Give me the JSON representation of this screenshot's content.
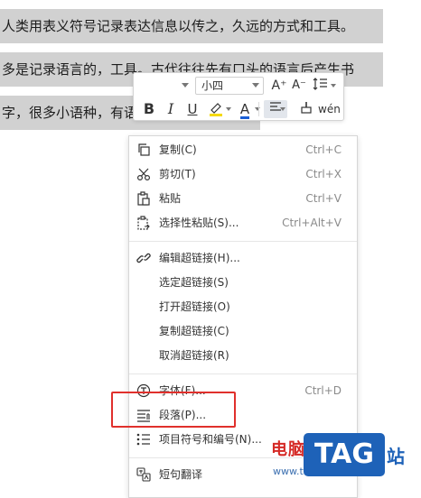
{
  "document": {
    "lines": [
      "人类用表义符号记录表达信息以传之，久远的方式和工具。",
      "多是记录语言的，工具。古代往往先有口头的语言后产生书",
      "字，很多小语种，有语言但没有文字。"
    ]
  },
  "toolbar": {
    "font_value": "",
    "size_value": "小四",
    "bold": "B",
    "italic": "I",
    "underline": "U",
    "font_color_letter": "A",
    "grow_font": "A⁺",
    "shrink_font": "A⁻",
    "pinyin": "wén",
    "accent_color": "#1a5fd6",
    "highlight_color": "#f5d90a"
  },
  "context_menu": {
    "items": [
      {
        "id": "copy",
        "label": "复制(C)",
        "shortcut": "Ctrl+C",
        "icon": "copy-icon"
      },
      {
        "id": "cut",
        "label": "剪切(T)",
        "shortcut": "Ctrl+X",
        "icon": "scissors-icon"
      },
      {
        "id": "paste",
        "label": "粘贴",
        "shortcut": "Ctrl+V",
        "icon": "paste-icon"
      },
      {
        "id": "paste-special",
        "label": "选择性粘贴(S)...",
        "shortcut": "Ctrl+Alt+V",
        "icon": "paste-special-icon"
      },
      {
        "id": "edit-hyperlink",
        "label": "编辑超链接(H)...",
        "shortcut": "",
        "icon": "link-icon"
      },
      {
        "id": "select-hyperlink",
        "label": "选定超链接(S)",
        "shortcut": "",
        "icon": ""
      },
      {
        "id": "open-hyperlink",
        "label": "打开超链接(O)",
        "shortcut": "",
        "icon": ""
      },
      {
        "id": "copy-hyperlink",
        "label": "复制超链接(C)",
        "shortcut": "",
        "icon": ""
      },
      {
        "id": "remove-hyperlink",
        "label": "取消超链接(R)",
        "shortcut": "",
        "icon": ""
      },
      {
        "id": "font",
        "label": "字体(F)...",
        "shortcut": "Ctrl+D",
        "icon": "font-icon"
      },
      {
        "id": "paragraph",
        "label": "段落(P)...",
        "shortcut": "",
        "icon": "paragraph-icon"
      },
      {
        "id": "bullets",
        "label": "项目符号和编号(N)...",
        "shortcut": "",
        "icon": "list-icon"
      },
      {
        "id": "translate",
        "label": "短句翻译",
        "shortcut": "",
        "icon": "translate-icon"
      }
    ]
  },
  "watermark": {
    "site_name": "电脑技术网",
    "url": "www.tagxp.com",
    "tag": "TAG",
    "zhan": "站",
    "brand_red": "#d52a26",
    "brand_blue": "#1e62b8"
  }
}
